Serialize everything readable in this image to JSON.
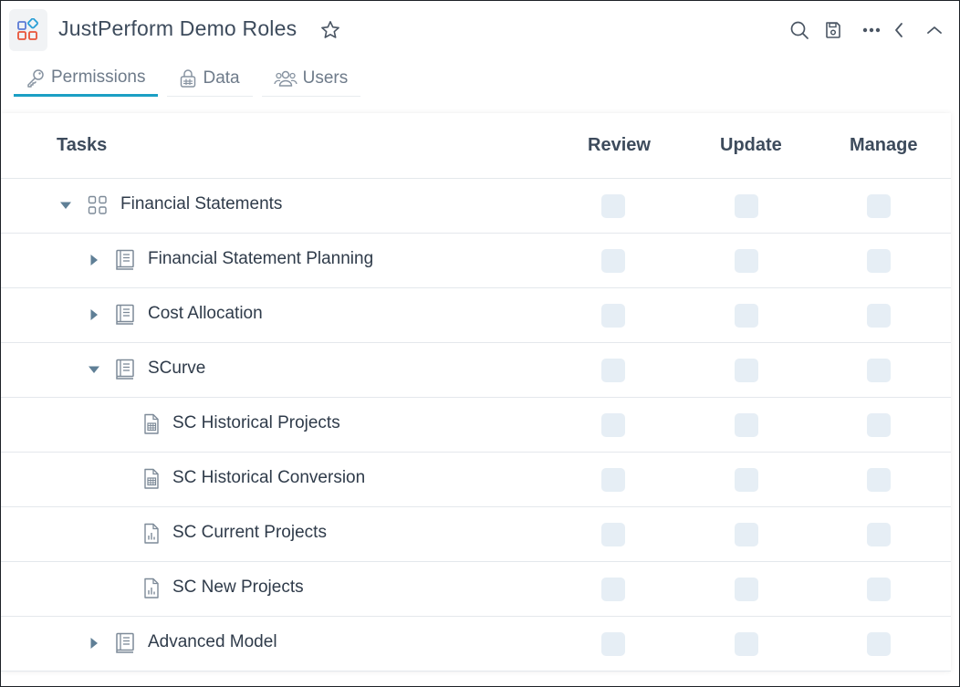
{
  "header": {
    "title": "JustPerform Demo Roles",
    "icons": [
      "app-logo-icon",
      "star-icon",
      "search-icon",
      "save-icon",
      "more-icon",
      "chevron-left-icon",
      "chevron-up-icon"
    ]
  },
  "tabs": [
    {
      "label": "Permissions",
      "icon": "key-icon",
      "active": true
    },
    {
      "label": "Data",
      "icon": "data-lock-icon",
      "active": false
    },
    {
      "label": "Users",
      "icon": "users-icon",
      "active": false
    }
  ],
  "table": {
    "columns": {
      "tasks": "Tasks",
      "review": "Review",
      "update": "Update",
      "manage": "Manage"
    },
    "rows": [
      {
        "label": "Financial Statements",
        "level": 0,
        "expander": "expanded",
        "icon": "grid-icon"
      },
      {
        "label": "Financial Statement Planning",
        "level": 1,
        "expander": "collapsed",
        "icon": "book-icon"
      },
      {
        "label": "Cost Allocation",
        "level": 1,
        "expander": "collapsed",
        "icon": "book-icon"
      },
      {
        "label": "SCurve",
        "level": 1,
        "expander": "expanded",
        "icon": "book-icon"
      },
      {
        "label": "SC Historical Projects",
        "level": 2,
        "expander": "none",
        "icon": "table-doc-icon"
      },
      {
        "label": "SC Historical Conversion",
        "level": 2,
        "expander": "none",
        "icon": "table-doc-icon"
      },
      {
        "label": "SC Current Projects",
        "level": 2,
        "expander": "none",
        "icon": "chart-doc-icon"
      },
      {
        "label": "SC New Projects",
        "level": 2,
        "expander": "none",
        "icon": "chart-doc-icon"
      },
      {
        "label": "Advanced Model",
        "level": 1,
        "expander": "collapsed",
        "icon": "book-icon"
      }
    ]
  },
  "colors": {
    "accent": "#1b9fc4",
    "checkbox": "#e6eef5",
    "text": "#2f3b4a"
  }
}
